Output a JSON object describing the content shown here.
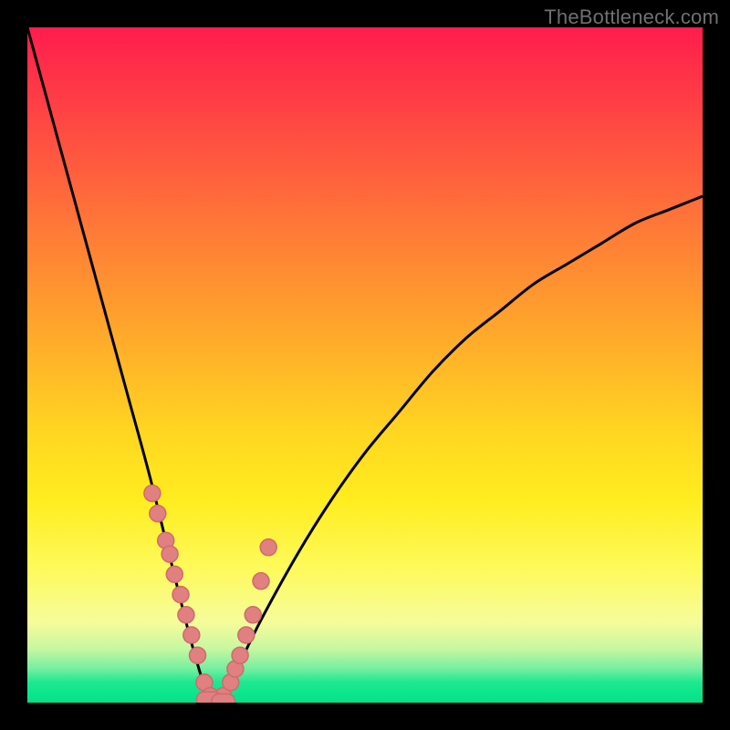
{
  "watermark": "TheBottleneck.com",
  "colors": {
    "background": "#000000",
    "gradient_top": "#ff1d4d",
    "gradient_bottom": "#01e28a",
    "curve": "#000000",
    "marker_fill": "#e08080",
    "marker_stroke": "#cf6b6b"
  },
  "chart_data": {
    "type": "line",
    "title": "",
    "xlabel": "",
    "ylabel": "",
    "xlim": [
      0,
      100
    ],
    "ylim": [
      0,
      100
    ],
    "grid": false,
    "legend": false,
    "note": "No numeric axis ticks or labels are rendered; x/y units are normalized 0–100. Curve is a V-shaped bottleneck profile with minimum near x≈27.",
    "series": [
      {
        "name": "bottleneck-curve",
        "x": [
          0,
          3,
          6,
          9,
          12,
          15,
          18,
          21,
          24,
          26,
          27,
          28,
          29,
          30,
          32,
          35,
          40,
          45,
          50,
          55,
          60,
          65,
          70,
          75,
          80,
          85,
          90,
          95,
          100
        ],
        "y": [
          100,
          89,
          78,
          67,
          56,
          45,
          34,
          22,
          10,
          3,
          0,
          0,
          1,
          3,
          7,
          13,
          22,
          30,
          37,
          43,
          49,
          54,
          58,
          62,
          65,
          68,
          71,
          73,
          75
        ]
      }
    ],
    "markers": {
      "name": "highlighted-points",
      "x": [
        18.5,
        19.3,
        20.5,
        21.1,
        21.8,
        22.7,
        23.5,
        24.3,
        25.2,
        26.2,
        27.1,
        28.0,
        29.0,
        30.1,
        30.8,
        31.5,
        32.4,
        33.4,
        34.6,
        35.7
      ],
      "y": [
        31,
        28,
        24,
        22,
        19,
        16,
        13,
        10,
        7,
        3,
        1,
        0,
        1,
        3,
        5,
        7,
        10,
        13,
        18,
        23
      ]
    }
  }
}
